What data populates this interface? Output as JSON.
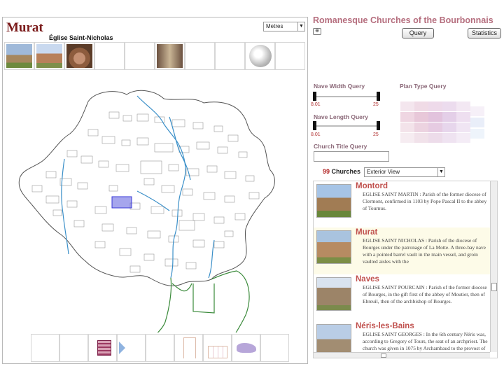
{
  "left": {
    "church_name": "Murat",
    "units_select": "Metres",
    "subtitle": "Église Saint-Nicholas"
  },
  "header": {
    "app_title": "Romanesque Churches of the Bourbonnais",
    "zoom_label": "⊕",
    "query_button": "Query",
    "statistics_button": "Statistics"
  },
  "queries": {
    "nave_width": {
      "label": "Nave Width Query",
      "min": "8.01",
      "max": "25"
    },
    "nave_length": {
      "label": "Nave Length Query",
      "min": "8.01",
      "max": "25"
    },
    "plan_type": {
      "label": "Plan Type Query"
    },
    "church_title": {
      "label": "Church Title Query",
      "value": ""
    }
  },
  "results": {
    "count": "99",
    "count_label": "Churches",
    "view_select": "Exterior View",
    "items": [
      {
        "name": "Montord",
        "desc": "EGLISE SAINT MARTIN : Parish of the former diocese of Clermont, confirmed in 1103 by Pope Pascal II to the abbey of Tournus."
      },
      {
        "name": "Murat",
        "desc": "EGLISE SAINT NICHOLAS : Parish of the diocese of Bourges under the patronage of La Motte. A three-bay nave with a pointed barrel vault in the main vessel, and groin vaulted aisles with the"
      },
      {
        "name": "Naves",
        "desc": "EGLISE SAINT POURCAIN : Parish of the former diocese of Bourges, in the gift first of the abbey of Moutier, then of Ebreuil, then of the archbishop of Bourges."
      },
      {
        "name": "Néris-les-Bains",
        "desc": "EGLISE SAINT GEORGES : In the 6th century Néris was, according to Gregory of Tours, the seat of an archpriest. The church was given in 1075 by Archambaud to the provost of Evaux, with"
      }
    ]
  },
  "colors": {
    "title_red": "#7a1a1a",
    "app_title_pink": "#b56e7e",
    "result_name": "#c0504d",
    "river": "#3a8fc8",
    "boundary_green": "#3a8a3a",
    "highlight": "#3a3ad8"
  }
}
